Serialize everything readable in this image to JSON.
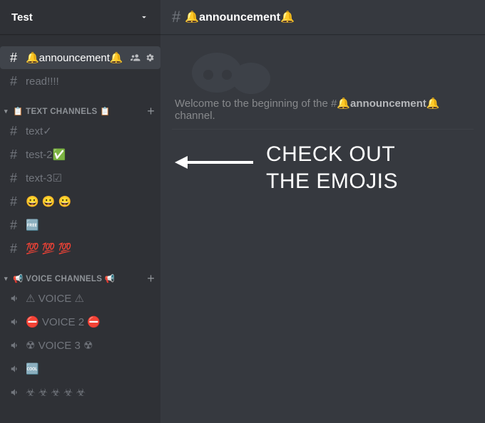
{
  "server": {
    "name": "Test"
  },
  "selected_channel": {
    "hash": "#",
    "name": "🔔announcement🔔"
  },
  "top_channels": [
    {
      "hash": "#",
      "label": "🔔announcement🔔",
      "selected": true
    },
    {
      "hash": "#",
      "label": "read!!!!",
      "selected": false
    }
  ],
  "categories": [
    {
      "label": "📋 TEXT CHANNELS 📋",
      "type": "text",
      "channels": [
        {
          "label": "text✓"
        },
        {
          "label": "test-2✅"
        },
        {
          "label": "text-3☑"
        },
        {
          "label": "😀 😀 😀"
        },
        {
          "label": "🆓"
        },
        {
          "label": "💯 💯 💯"
        }
      ]
    },
    {
      "label": "📢 VOICE CHANNELS 📢",
      "type": "voice",
      "channels": [
        {
          "label": "⚠ VOICE ⚠"
        },
        {
          "label": "⛔ VOICE 2 ⛔"
        },
        {
          "label": "☢ VOICE 3 ☢"
        },
        {
          "label": "🆒"
        },
        {
          "label": "☣ ☣ ☣ ☣ ☣"
        }
      ]
    }
  ],
  "welcome": {
    "prefix": "Welcome to the beginning of the ",
    "hash": "#",
    "channel": "🔔announcement🔔",
    "suffix": " channel."
  },
  "annotation": {
    "line1": "CHECK OUT",
    "line2": "THE EMOJIS"
  }
}
